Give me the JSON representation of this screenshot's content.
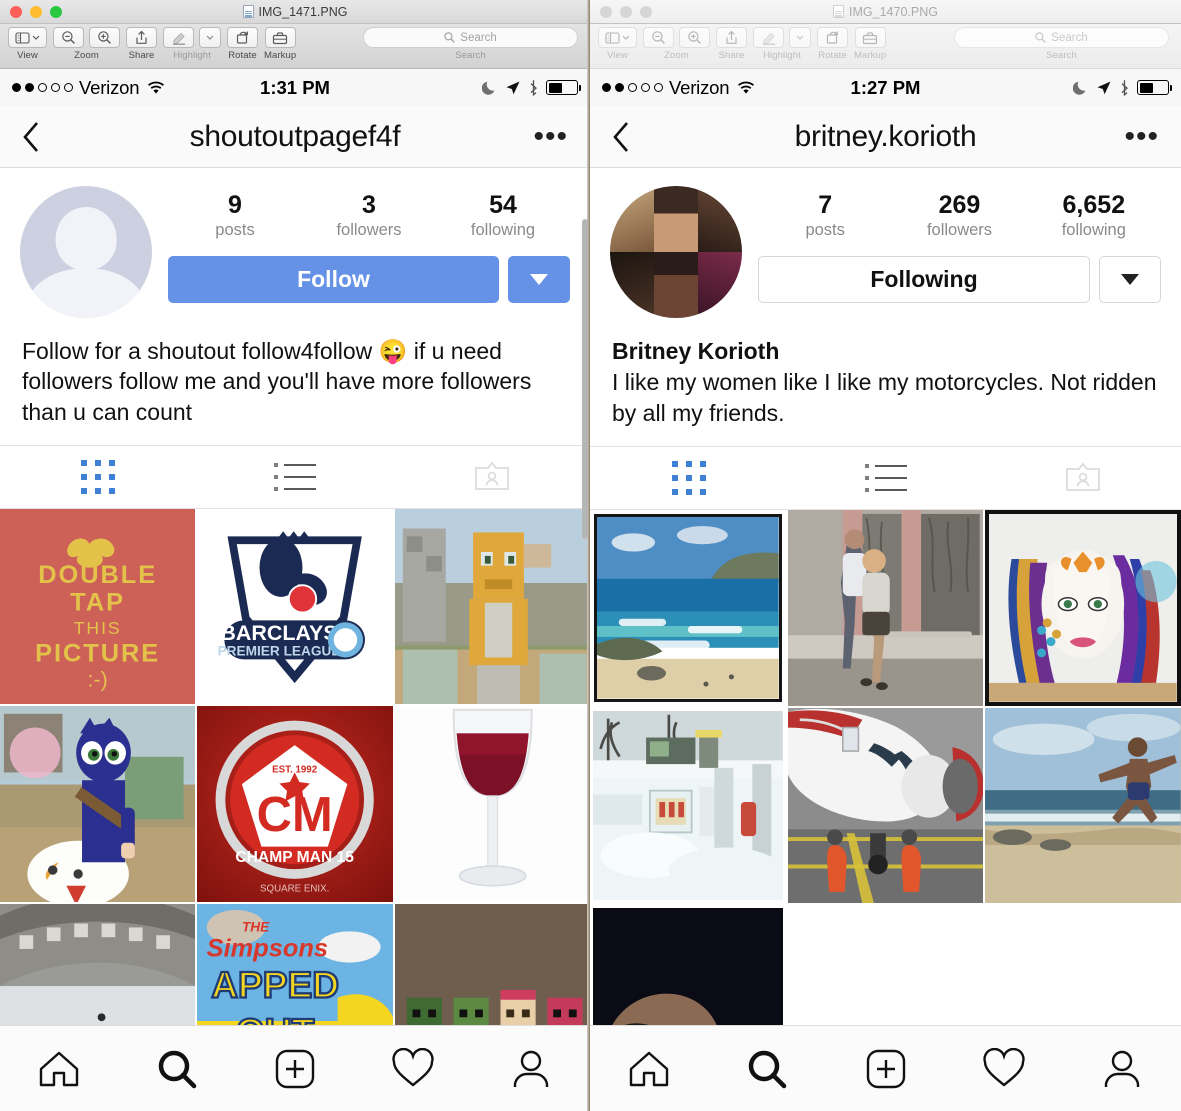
{
  "windows": [
    {
      "id": "left",
      "active": true,
      "title": "IMG_1471.PNG",
      "toolbar": {
        "view_label": "View",
        "zoom_label": "Zoom",
        "share_label": "Share",
        "highlight_label": "Highlight",
        "rotate_label": "Rotate",
        "markup_label": "Markup",
        "search_group_label": "Search",
        "search_placeholder": "Search"
      },
      "statusbar": {
        "carrier": "Verizon",
        "signal_bars_filled": 2,
        "signal_bars_total": 5,
        "time": "1:31 PM",
        "icons": [
          "wifi-icon",
          "do-not-disturb-icon",
          "location-icon",
          "bluetooth-icon",
          "battery-icon"
        ]
      },
      "navbar": {
        "title": "shoutoutpagef4f",
        "back": "back-chevron",
        "more": "•••"
      },
      "profile": {
        "avatar_type": "placeholder",
        "stats": [
          {
            "value": "9",
            "label": "posts"
          },
          {
            "value": "3",
            "label": "followers"
          },
          {
            "value": "54",
            "label": "following"
          }
        ],
        "primary_button": "Follow",
        "primary_button_style": "filled",
        "primary_button_color": "#6592e6",
        "dropdown": "▼",
        "full_name": "",
        "bio": "Follow for a shoutout follow4follow 😜 if u need followers follow me and you'll have more followers than u can count"
      },
      "tabs": [
        "grid-view-tab",
        "list-view-tab",
        "tagged-photos-tab"
      ],
      "active_tab": "grid-view-tab",
      "posts": [
        {
          "name": "double-tap-this-picture-poster",
          "alt": "DOUBLE TAP THIS PICTURE :-)"
        },
        {
          "name": "barclays-premier-league-logo",
          "alt": "BARCLAYS PREMIER LEAGUE"
        },
        {
          "name": "minecraft-stampy-cat-screenshot",
          "alt": "Minecraft orange cat character"
        },
        {
          "name": "clumsy-ninja-game-character",
          "alt": "Blue ninja riding chicken"
        },
        {
          "name": "champ-man-15-logo",
          "alt": "CHAMP MAN 15 EST. 1992 SQUARE ENIX"
        },
        {
          "name": "red-wine-glass-photo",
          "alt": "Glass of red wine"
        },
        {
          "name": "stadium-arena-photo",
          "alt": "Stadium roof"
        },
        {
          "name": "simpsons-tapped-out-banner",
          "alt": "THE SIMPSONS TAPPED OUT"
        },
        {
          "name": "minecraft-pixel-characters",
          "alt": "Pixel art characters"
        }
      ],
      "bottomnav": [
        "home-icon",
        "search-icon",
        "add-post-icon",
        "activity-heart-icon",
        "profile-person-icon"
      ]
    },
    {
      "id": "right",
      "active": false,
      "title": "IMG_1470.PNG",
      "toolbar": {
        "view_label": "View",
        "zoom_label": "Zoom",
        "share_label": "Share",
        "highlight_label": "Highlight",
        "rotate_label": "Rotate",
        "markup_label": "Markup",
        "search_group_label": "Search",
        "search_placeholder": "Search"
      },
      "statusbar": {
        "carrier": "Verizon",
        "signal_bars_filled": 2,
        "signal_bars_total": 5,
        "time": "1:27 PM",
        "icons": [
          "wifi-icon",
          "do-not-disturb-icon",
          "location-icon",
          "bluetooth-icon",
          "battery-icon"
        ]
      },
      "navbar": {
        "title": "britney.korioth",
        "back": "back-chevron",
        "more": "•••"
      },
      "profile": {
        "avatar_type": "photo-collage",
        "stats": [
          {
            "value": "7",
            "label": "posts"
          },
          {
            "value": "269",
            "label": "followers"
          },
          {
            "value": "6,652",
            "label": "following"
          }
        ],
        "primary_button": "Following",
        "primary_button_style": "outline",
        "primary_button_color": "#ffffff",
        "dropdown": "▼",
        "full_name": "Britney Korioth",
        "bio": "I like my women like I like my motorcycles. Not ridden by all my friends."
      },
      "tabs": [
        "grid-view-tab",
        "list-view-tab",
        "tagged-photos-tab"
      ],
      "active_tab": "grid-view-tab",
      "posts": [
        {
          "name": "hawaii-beach-coastline-photo",
          "alt": "Beach and ocean coastline"
        },
        {
          "name": "two-people-storefront-photo",
          "alt": "Couple by shop window"
        },
        {
          "name": "colorful-woman-face-artwork",
          "alt": "Painted face with butterfly"
        },
        {
          "name": "snowy-winter-scene-photo",
          "alt": "Snow covered equipment"
        },
        {
          "name": "airplane-ground-crew-photo",
          "alt": "Jet nose with ground crew"
        },
        {
          "name": "man-jumping-beach-photo",
          "alt": "Man jumping on beach"
        },
        {
          "name": "dark-portrait-eyes-photo",
          "alt": "Dark photo of eyes"
        }
      ],
      "bottomnav": [
        "home-icon",
        "search-icon",
        "add-post-icon",
        "activity-heart-icon",
        "profile-person-icon"
      ]
    }
  ],
  "colors": {
    "instagram_blue": "#3f7fd4",
    "follow_button": "#6592e6",
    "desktop_background": "#6b6253"
  }
}
